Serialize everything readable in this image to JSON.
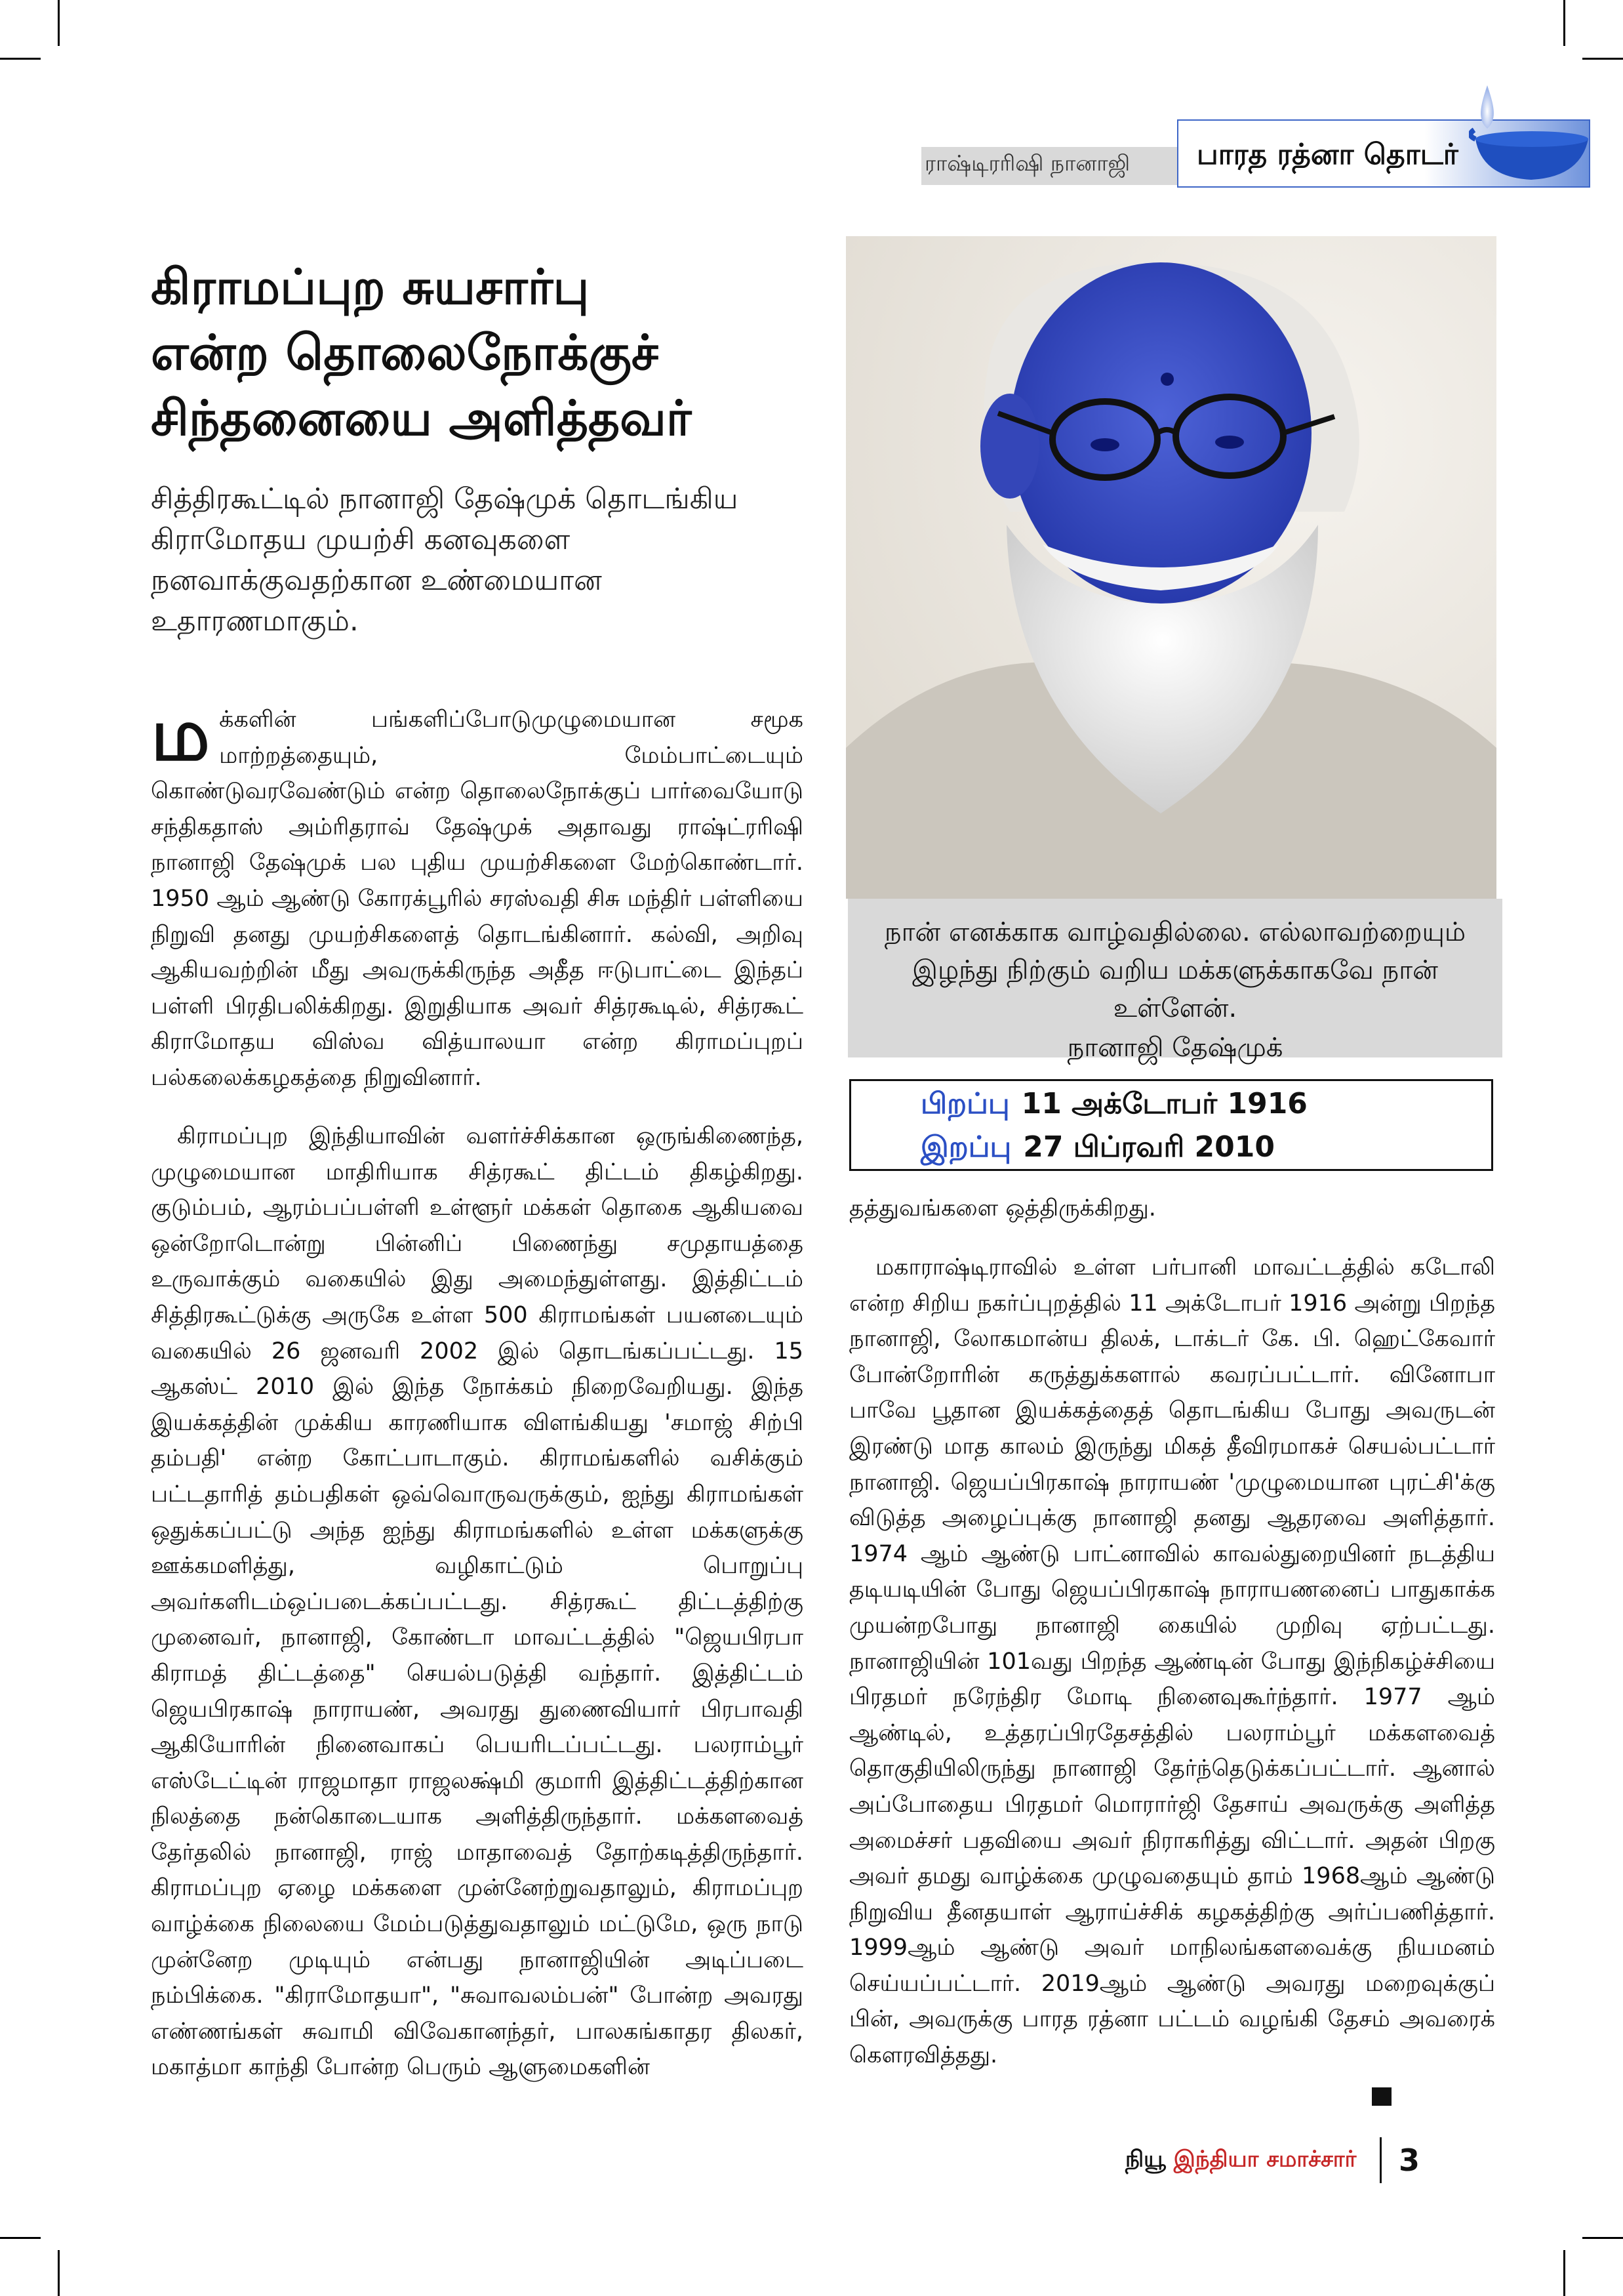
{
  "header": {
    "kicker": "ராஷ்டிரரிஷி நானாஜி",
    "series": "பாரத ரத்னா தொடர்"
  },
  "article": {
    "headline": [
      "கிராமப்புற சுயசார்பு",
      "என்ற தொலைநோக்குச்",
      "சிந்தனையை அளித்தவர்"
    ],
    "deck": "சித்திரகூட்டில் நானாஜி தேஷ்முக் தொடங்கிய கிராமோதய முயற்சி கனவுகளை நனவாக்குவதற்கான உண்மையான உதாரணமாகும்.",
    "dropcap": "ம",
    "col1_para1": "க்களின் பங்களிப்போடுமுழுமையான சமூக மாற்றத்தையும், மேம்பாட்டையும் கொண்டுவரவேண்டும் என்ற தொலைநோக்குப் பார்வையோடு சந்திகதாஸ் அம்ரிதராவ் தேஷ்முக் அதாவது ராஷ்ட்ரரிஷி நானாஜி தேஷ்முக் பல புதிய முயற்சிகளை மேற்கொண்டார். 1950 ஆம் ஆண்டு கோரக்பூரில் சரஸ்வதி சிசு மந்திர் பள்ளியை நிறுவி தனது முயற்சிகளைத் தொடங்கினார். கல்வி, அறிவு ஆகியவற்றின் மீது அவருக்கிருந்த அதீத ஈடுபாட்டை இந்தப் பள்ளி பிரதிபலிக்கிறது. இறுதியாக அவர் சித்ரகூடில், சித்ரகூட் கிராமோதய விஸ்வ வித்யாலயா என்ற கிராமப்புறப் பல்கலைக்கழகத்தை நிறுவினார்.",
    "col1_para2": "கிராமப்புற இந்தியாவின் வளர்ச்சிக்கான ஒருங்கிணைந்த, முழுமையான மாதிரியாக சித்ரகூட் திட்டம் திகழ்கிறது. குடும்பம், ஆரம்பப்பள்ளி உள்ளூர் மக்கள் தொகை ஆகியவை ஒன்றோடொன்று பின்னிப் பிணைந்து சமுதாயத்தை உருவாக்கும் வகையில் இது அமைந்துள்ளது. இத்திட்டம் சித்திரகூட்டுக்கு அருகே உள்ள 500 கிராமங்கள் பயனடையும் வகையில் 26 ஜனவரி 2002 இல் தொடங்கப்பட்டது. 15 ஆகஸ்ட் 2010 இல் இந்த நோக்கம் நிறைவேறியது. இந்த இயக்கத்தின் முக்கிய காரணியாக விளங்கியது 'சமாஜ் சிற்பி தம்பதி' என்ற கோட்பாடாகும். கிராமங்களில் வசிக்கும் பட்டதாரித் தம்பதிகள் ஒவ்வொருவருக்கும், ஐந்து கிராமங்கள் ஒதுக்கப்பட்டு அந்த ஐந்து கிராமங்களில் உள்ள மக்களுக்கு ஊக்கமளித்து, வழிகாட்டும் பொறுப்பு அவர்களிடம்ஒப்படைக்கப்பட்டது. சித்ரகூட் திட்டத்திற்கு முனைவர், நானாஜி, கோண்டா மாவட்டத்தில் \"ஜெயபிரபா கிராமத் திட்டத்தை\" செயல்படுத்தி வந்தார். இத்திட்டம் ஜெயபிரகாஷ் நாராயண், அவரது துணைவியார் பிரபாவதி ஆகியோரின் நினைவாகப் பெயரிடப்பட்டது. பலராம்பூர் எஸ்டேட்டின் ராஜமாதா ராஜலக்ஷ்மி குமாரி இத்திட்டத்திற்கான நிலத்தை நன்கொடையாக அளித்திருந்தார். மக்களவைத் தேர்தலில் நானாஜி, ராஜ் மாதாவைத் தோற்கடித்திருந்தார். கிராமப்புற ஏழை மக்களை முன்னேற்றுவதாலும், கிராமப்புற வாழ்க்கை நிலையை மேம்படுத்துவதாலும் மட்டுமே, ஒரு நாடு முன்னேற முடியும் என்பது நானாஜியின் அடிப்படை நம்பிக்கை. \"கிராமோதயா\", \"சுவாவலம்பன்\" போன்ற அவரது எண்ணங்கள் சுவாமி விவேகானந்தர், பாலகங்காதர திலகர், மகாத்மா காந்தி போன்ற பெரும் ஆளுமைகளின்",
    "col2_para1": "தத்துவங்களை ஒத்திருக்கிறது.",
    "col2_para2": "மகாராஷ்டிராவில் உள்ள பர்பானி மாவட்டத்தில் கடோலி என்ற சிறிய நகர்ப்புறத்தில் 11 அக்டோபர் 1916 அன்று பிறந்த நானாஜி, லோகமான்ய திலக், டாக்டர் கே. பி. ஹெட்கேவார் போன்றோரின் கருத்துக்களால் கவரப்பட்டார். வினோபா பாவே பூதான இயக்கத்தைத் தொடங்கிய போது அவருடன் இரண்டு மாத காலம் இருந்து மிகத் தீவிரமாகச் செயல்பட்டார் நானாஜி. ஜெயப்பிரகாஷ் நாராயண் 'முழுமையான புரட்சி'க்கு விடுத்த அழைப்புக்கு நானாஜி தனது ஆதரவை அளித்தார். 1974 ஆம் ஆண்டு பாட்னாவில் காவல்துறையினர் நடத்திய தடியடியின் போது ஜெயப்பிரகாஷ் நாராயணனைப் பாதுகாக்க முயன்றபோது நானாஜி கையில் முறிவு ஏற்பட்டது. நானாஜியின் 101வது பிறந்த ஆண்டின் போது இந்நிகழ்ச்சியை பிரதமர் நரேந்திர மோடி நினைவுகூர்ந்தார். 1977 ஆம் ஆண்டில், உத்தரப்பிரதேசத்தில் பலராம்பூர் மக்களவைத் தொகுதியிலிருந்து நானாஜி தேர்ந்தெடுக்கப்பட்டார். ஆனால் அப்போதைய பிரதமர் மொரார்ஜி தேசாய் அவருக்கு அளித்த அமைச்சர் பதவியை அவர் நிராகரித்து விட்டார். அதன் பிறகு அவர் தமது வாழ்க்கை முழுவதையும் தாம் 1968ஆம் ஆண்டு நிறுவிய தீனதயாள் ஆராய்ச்சிக் கழகத்திற்கு அர்ப்பணித்தார். 1999ஆம் ஆண்டு அவர் மாநிலங்களவைக்கு நியமனம் செய்யப்பட்டார். 2019ஆம் ஆண்டு அவரது மறைவுக்குப் பின், அவருக்கு பாரத ரத்னா பட்டம் வழங்கி தேசம் அவரைக் கௌரவித்தது."
  },
  "quote": {
    "text": "நான் எனக்காக வாழ்வதில்லை. எல்லாவற்றையும் இழந்து நிற்கும் வறிய மக்களுக்காகவே நான் உள்ளேன்.",
    "author": "நானாஜி தேஷ்முக்"
  },
  "dates": {
    "birth_label": "பிறப்பு",
    "birth_value": "11 அக்டோபர் 1916",
    "death_label": "இறப்பு",
    "death_value": "27 பிப்ரவரி 2010"
  },
  "footer": {
    "publication_prefix": "நியூ",
    "publication_name": "இந்தியா சமாச்சார்",
    "page_number": "3"
  },
  "colors": {
    "accent_blue": "#2b4fc4",
    "quote_bg": "#d9d9d9",
    "publication_red": "#c62828"
  },
  "icons": {
    "lamp": "oil-lamp-icon",
    "end_mark": "end-square-icon"
  }
}
